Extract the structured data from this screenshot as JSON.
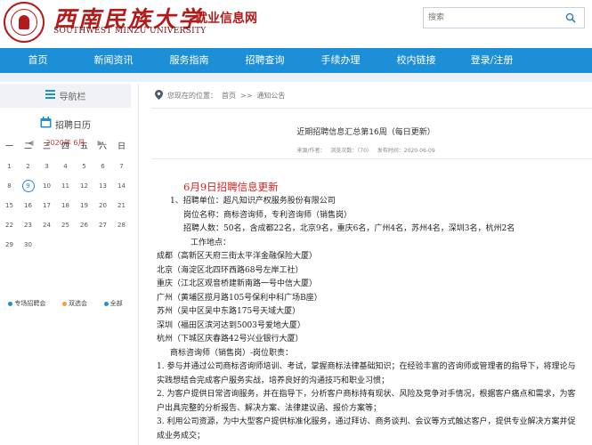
{
  "header": {
    "logo_cn": "西南民族大学",
    "logo_en": "SOUTHWEST MINZU UNIVERSITY",
    "site_name": "就业信息网",
    "search_placeholder": "搜索"
  },
  "nav": [
    "首页",
    "新闻资讯",
    "服务指南",
    "招聘查询",
    "手续办理",
    "校内链接",
    "登录/注册"
  ],
  "sidebar": {
    "nav_label": "导航栏",
    "calendar_title": "招聘日历",
    "month_label": "2020年  6月",
    "weekdays": [
      "一",
      "二",
      "三",
      "四",
      "五",
      "六",
      "日"
    ],
    "weeks": [
      [
        "1",
        "2",
        "3",
        "4",
        "5",
        "6",
        "7"
      ],
      [
        "8",
        "9",
        "10",
        "11",
        "12",
        "13",
        "14"
      ],
      [
        "15",
        "16",
        "17",
        "18",
        "19",
        "20",
        "21"
      ],
      [
        "22",
        "23",
        "24",
        "25",
        "26",
        "27",
        "28"
      ],
      [
        "29",
        "30",
        "",
        "",
        "",
        "",
        ""
      ]
    ],
    "today": "9",
    "legend": [
      {
        "label": "专场招聘会",
        "color": "#1c8fd6"
      },
      {
        "label": "双选会",
        "color": "#f0a030"
      },
      {
        "label": "全部",
        "color": "#1c8fd6"
      }
    ]
  },
  "main": {
    "breadcrumb_prefix": "您现在的位置：",
    "breadcrumb_home": "首页",
    "breadcrumb_sep": ">>",
    "breadcrumb_current": "通知公告",
    "article_title": "近期招聘信息汇总第16周（每日更新）",
    "meta": "来源/作者：     浏览次数：（70）     发布时间：2020-06-09",
    "lines": [
      {
        "text": "6月9日招聘信息更新",
        "style": "red"
      },
      {
        "text": "1、招聘单位：超凡知识产权服务股份有限公司",
        "style": "i1"
      },
      {
        "text": "岗位名称：商标咨询师，专利咨询师（销售岗）",
        "style": "i2"
      },
      {
        "text": "招聘人数：50名，含成都22名，北京9名，重庆6名，广州4名，苏州4名，深圳3名，杭州2名",
        "style": "i2"
      },
      {
        "text": "工作地点：",
        "style": "i3"
      },
      {
        "text": "成都（高新区天府三街太平洋金融保险大厦）",
        "style": ""
      },
      {
        "text": "北京（海淀区北四环西路68号左岸工社）",
        "style": ""
      },
      {
        "text": "重庆（江北区观音桥建新南路一号中信大厦）",
        "style": ""
      },
      {
        "text": "广州（黄埔区揽月路105号保利中科广场B座）",
        "style": ""
      },
      {
        "text": "苏州（吴中区吴中东路175号天域大厦）",
        "style": ""
      },
      {
        "text": "深圳（福田区滨河达到5003号爱地大厦）",
        "style": ""
      },
      {
        "text": "杭州（下城区庆春路42号兴业银行大厦）",
        "style": ""
      },
      {
        "text": "商标咨询师（销售岗）-岗位职责：",
        "style": "i1"
      },
      {
        "text": "1.   参与并通过公司商标咨询师培训、考试，掌握商标法律基础知识；在经验丰富的咨询师或管理者的指导下，将理论与实践想结合完成客户服务实战，培养良好的沟通技巧和职业习惯；",
        "style": "wrap"
      },
      {
        "text": "2.   为客户提供日常咨询服务，并在指导下，分析客户商标持有现状、风险及竞争对手情况，根据客户痛点和需求，为客户出具完整的分析报告、解决方案、法律建议函、报价方案等；",
        "style": "wrap"
      },
      {
        "text": "3.   利用公司资源，为中大型客户提供标准化服务，通过拜访、商务谈判、会议等方式触达客户，提供专业解决方案并促成业务成交；",
        "style": "wrap"
      }
    ]
  }
}
